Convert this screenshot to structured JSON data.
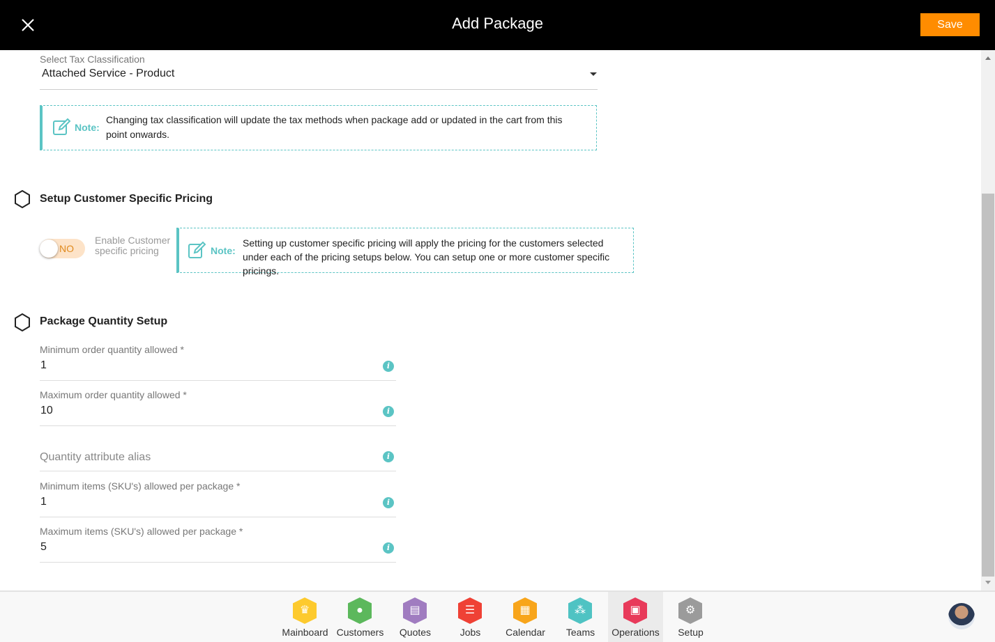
{
  "header": {
    "title": "Add Package",
    "save_label": "Save"
  },
  "tax": {
    "label": "Select Tax Classification",
    "value": "Attached Service - Product",
    "note_label": "Note:",
    "note_text": "Changing tax classification will update the tax methods when package add or updated in the cart from this point onwards."
  },
  "pricing": {
    "title": "Setup Customer Specific Pricing",
    "toggle_state": "NO",
    "toggle_label": "Enable Customer specific pricing",
    "note_label": "Note:",
    "note_text": "Setting up customer specific pricing will apply the pricing for the customers selected under each of the pricing setups below. You can setup one or more customer specific pricings."
  },
  "quantity": {
    "title": "Package Quantity Setup",
    "fields": [
      {
        "label": "Minimum order quantity allowed *",
        "value": "1"
      },
      {
        "label": "Maximum order quantity allowed *",
        "value": "10"
      },
      {
        "label": "",
        "value": "",
        "placeholder": "Quantity attribute alias"
      },
      {
        "label": "Minimum items (SKU's) allowed per package *",
        "value": "1"
      },
      {
        "label": "Maximum items (SKU's) allowed per package *",
        "value": "5"
      }
    ]
  },
  "nav": {
    "items": [
      {
        "label": "Mainboard",
        "color": "#fdca2e",
        "icon": "mainboard-icon"
      },
      {
        "label": "Customers",
        "color": "#5cb85c",
        "icon": "customer-icon"
      },
      {
        "label": "Quotes",
        "color": "#a07cc0",
        "icon": "quotes-icon"
      },
      {
        "label": "Jobs",
        "color": "#ef4135",
        "icon": "jobs-icon"
      },
      {
        "label": "Calendar",
        "color": "#f8a51b",
        "icon": "calendar-icon"
      },
      {
        "label": "Teams",
        "color": "#4fc3c3",
        "icon": "teams-icon"
      },
      {
        "label": "Operations",
        "color": "#e83a5a",
        "icon": "operations-icon",
        "active": true
      },
      {
        "label": "Setup",
        "color": "#9b9b9b",
        "icon": "gear-icon"
      }
    ]
  }
}
